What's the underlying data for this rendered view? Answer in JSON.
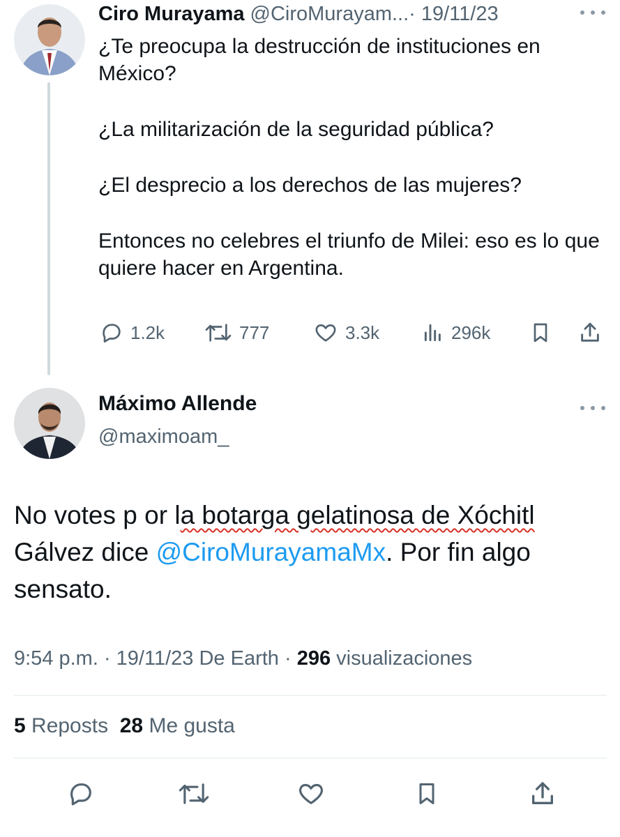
{
  "parent_tweet": {
    "author_name": "Ciro Murayama",
    "author_handle": "@CiroMurayam...",
    "date": " · 19/11/23",
    "paragraphs": [
      "¿Te preocupa la destrucción de instituciones en México?",
      "¿La militarización de la seguridad pública?",
      "¿El desprecio a los derechos de las mujeres?",
      "Entonces no celebres el triunfo de Milei: eso es lo que quiere hacer en Argentina."
    ],
    "metrics": {
      "replies": "1.2k",
      "reposts": "777",
      "likes": "3.3k",
      "views": "296k"
    }
  },
  "reply_tweet": {
    "author_name": "Máximo Allende",
    "author_handle": "@maximoam_",
    "text_part1": "No votes p or l",
    "text_underlined": "a botarga gelatinosa de Xóchitl",
    "text_part2": " Gálvez dice ",
    "mention": "@CiroMurayamaMx",
    "text_part3": ". Por fin algo sensato.",
    "time": "9:54 p.m.",
    "date_source": " · 19/11/23 De Earth · ",
    "views_count": "296",
    "views_label": " visualizaciones",
    "reposts_count": "5",
    "reposts_label": " Reposts",
    "likes_count": "28",
    "likes_label": " Me gusta"
  },
  "colors": {
    "text_primary": "#0f1419",
    "text_secondary": "#536471",
    "mention": "#1d9bf0",
    "spellcheck_underline": "#d93025",
    "thread_line": "#cfd9de"
  },
  "icons": [
    "reply-icon",
    "repost-icon",
    "like-icon",
    "views-icon",
    "bookmark-icon",
    "share-icon",
    "more-icon"
  ]
}
